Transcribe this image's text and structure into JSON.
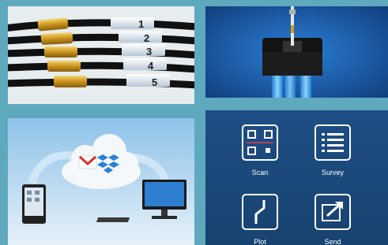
{
  "cables_panel": {
    "labels": [
      "1",
      "2",
      "3",
      "4",
      "5"
    ]
  },
  "cloud_panel": {
    "icons": [
      "gmail-icon",
      "dropbox-icon",
      "tablet-icon",
      "desktop-monitor-icon",
      "cloud-icon"
    ]
  },
  "menu": {
    "items": [
      {
        "label": "Scan",
        "icon": "qr-scan-icon"
      },
      {
        "label": "Survey",
        "icon": "list-icon"
      },
      {
        "label": "Plot",
        "icon": "route-plot-icon"
      },
      {
        "label": "Send",
        "icon": "send-icon"
      }
    ]
  },
  "colors": {
    "page_background": "#5fa9bf",
    "menu_background": "#1e4e86",
    "probe_background": "#1a5aa6",
    "gmail_red": "#d93025",
    "dropbox_blue": "#2a80d8"
  }
}
